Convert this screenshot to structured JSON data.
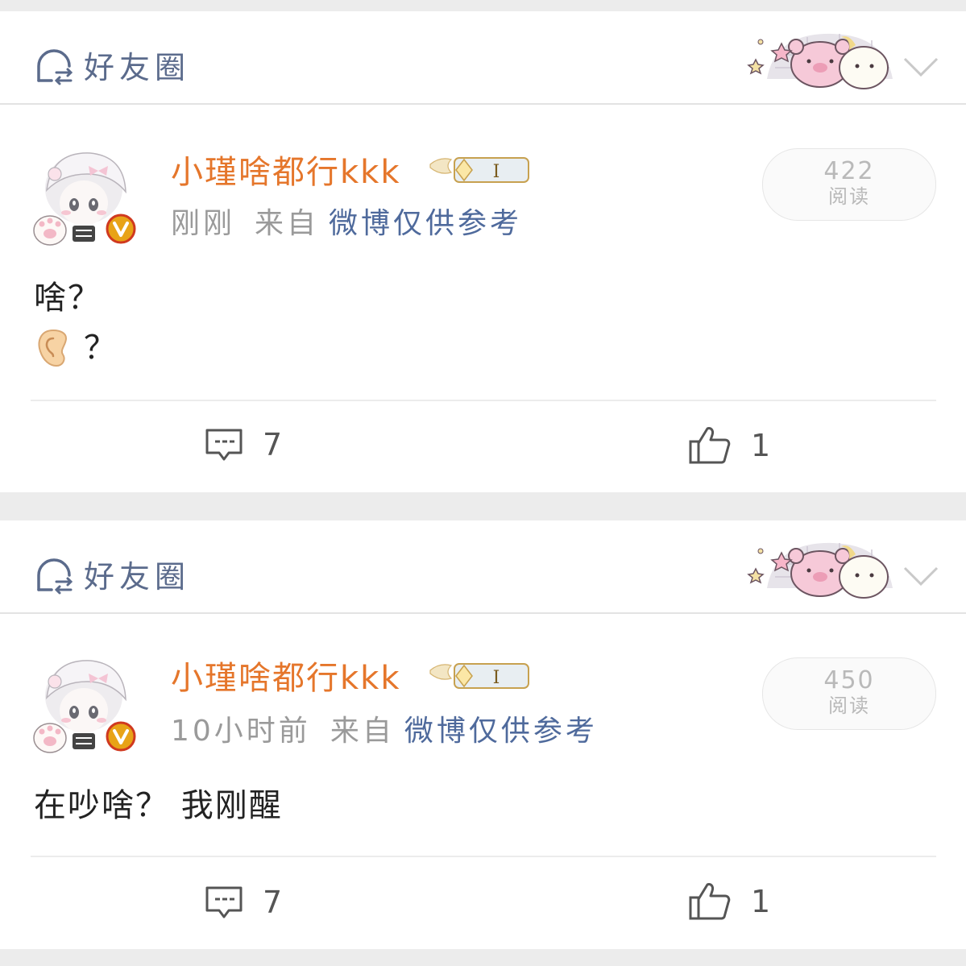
{
  "posts": [
    {
      "circle_label": "好友圈",
      "username": "小瑾啥都行kkk",
      "level": "I",
      "time": "刚刚",
      "from_label": "来自",
      "source": "微博仅供参考",
      "reads_count": "422",
      "reads_label": "阅读",
      "text_lines": [
        "啥？",
        "？"
      ],
      "comment_count": "7",
      "like_count": "1"
    },
    {
      "circle_label": "好友圈",
      "username": "小瑾啥都行kkk",
      "level": "I",
      "time": "10小时前",
      "from_label": "来自",
      "source": "微博仅供参考",
      "reads_count": "450",
      "reads_label": "阅读",
      "text_lines": [
        "在吵啥？ 我刚醒"
      ],
      "comment_count": "7",
      "like_count": "1"
    }
  ],
  "colors": {
    "username": "#e5762b",
    "source_link": "#4f6a9c",
    "verified_badge": "#e8a317"
  },
  "icons": {
    "circle": "friends-circle-icon",
    "ear": "ear-emoji-icon",
    "comment": "comment-icon",
    "like": "thumbs-up-icon",
    "collapse": "chevron-down-icon"
  }
}
